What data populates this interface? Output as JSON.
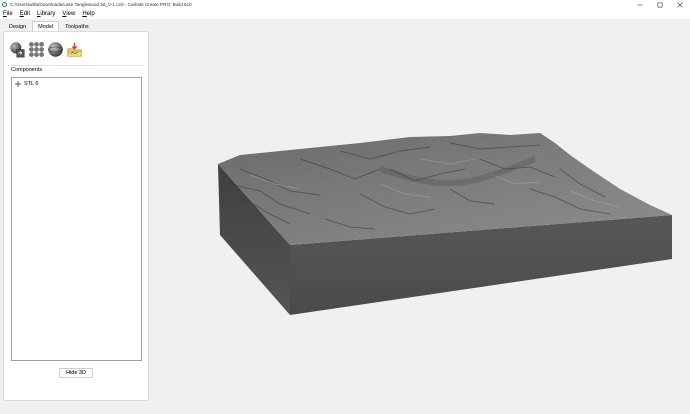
{
  "window": {
    "title": "C:/Users/willa/Downloads/Lake Tanglewood 3d_V-1.c2d - Carbide Create PRO; Build 810",
    "controls": [
      "minimize-icon",
      "maximize-icon",
      "close-icon"
    ]
  },
  "menubar": {
    "items": [
      {
        "label": "File",
        "mnemonic": "F"
      },
      {
        "label": "Edit",
        "mnemonic": "E"
      },
      {
        "label": "Library",
        "mnemonic": "L"
      },
      {
        "label": "View",
        "mnemonic": "V"
      },
      {
        "label": "Help",
        "mnemonic": "H"
      }
    ]
  },
  "sidebar": {
    "tabs": [
      {
        "label": "Design",
        "active": false
      },
      {
        "label": "Model",
        "active": true
      },
      {
        "label": "Toolpaths",
        "active": false
      }
    ],
    "tools": [
      "import-model-icon",
      "texture-grid-icon",
      "sphere-icon",
      "folder-import-icon"
    ],
    "components_label": "Components",
    "components": [
      {
        "label": "STL 6",
        "icon": "move-icon"
      }
    ],
    "hide3d_label": "Hide 3D"
  },
  "viewport": {
    "object": "3D terrain model"
  },
  "colors": {
    "background": "#f0f0f0",
    "terrain": "#6b6b6b",
    "terrain_side": "#4a4a4a"
  }
}
